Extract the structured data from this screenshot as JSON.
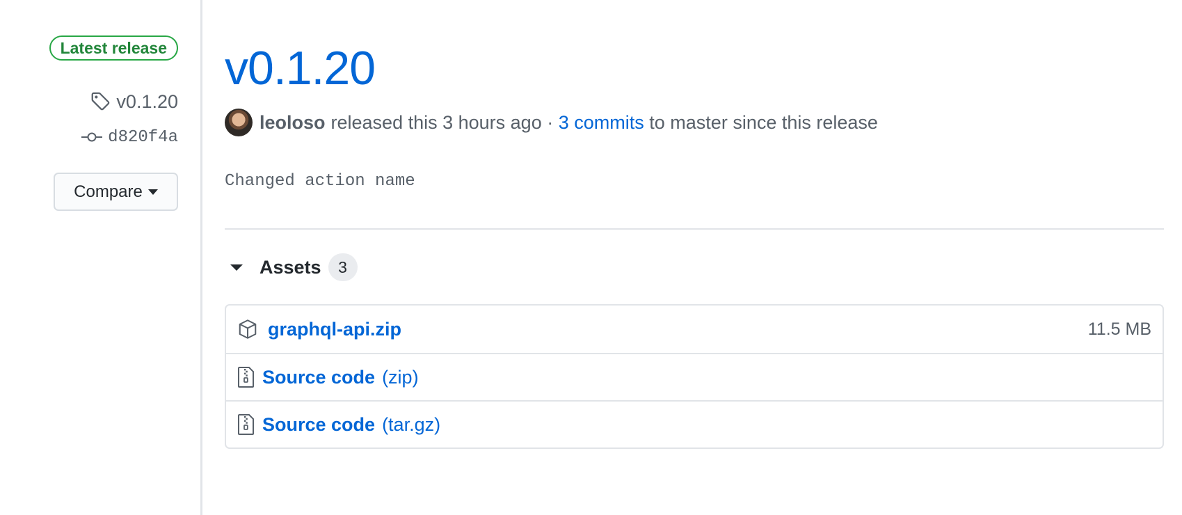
{
  "sidebar": {
    "badge": "Latest release",
    "tag": "v0.1.20",
    "commit": "d820f4a",
    "compare_label": "Compare"
  },
  "release": {
    "title": "v0.1.20",
    "author": "leoloso",
    "released_text": "released this 3 hours ago ·",
    "commits_link": "3 commits",
    "since_text": "to master since this release",
    "body": "Changed action name"
  },
  "assets": {
    "label": "Assets",
    "count": "3",
    "items": [
      {
        "name": "graphql-api.zip",
        "ext": "",
        "size": "11.5 MB",
        "icon": "package-icon"
      },
      {
        "name": "Source code",
        "ext": "(zip)",
        "size": "",
        "icon": "file-zip-icon"
      },
      {
        "name": "Source code",
        "ext": "(tar.gz)",
        "size": "",
        "icon": "file-zip-icon"
      }
    ]
  },
  "colors": {
    "link": "#0366d6",
    "badge_green": "#28a745",
    "muted": "#586069"
  }
}
